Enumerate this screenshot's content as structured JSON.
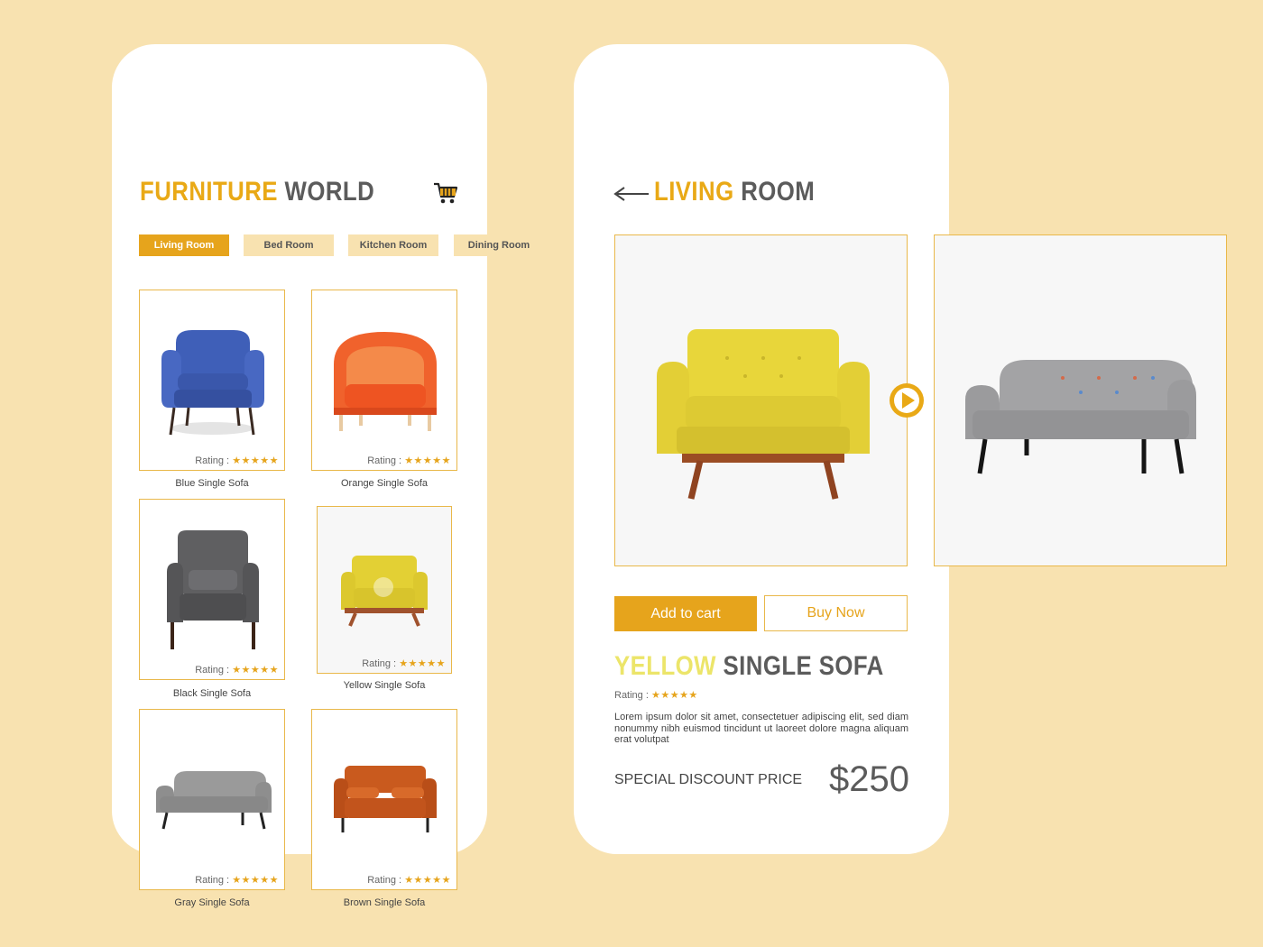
{
  "left": {
    "brand_a": "FURNITURE",
    "brand_b": "WORLD",
    "cart_icon": "shopping-cart-icon",
    "tabs": [
      "Living Room",
      "Bed Room",
      "Kitchen Room",
      "Dining Room"
    ],
    "rating_label": "Rating :",
    "stars": "★★★★★",
    "products": [
      {
        "name": "Blue Single Sofa",
        "color": "#3f5fb8"
      },
      {
        "name": "Orange Single Sofa",
        "color": "#f0622c"
      },
      {
        "name": "Black Single Sofa",
        "color": "#5a5a5c"
      },
      {
        "name": "Yellow Single Sofa",
        "color": "#e6d23a"
      },
      {
        "name": "Gray Single Sofa",
        "color": "#8e8e8e"
      },
      {
        "name": "Brown Single Sofa",
        "color": "#c95a1e"
      }
    ]
  },
  "right": {
    "back_icon": "arrow-left-icon",
    "title_a": "LIVING",
    "title_b": "ROOM",
    "next_icon": "play-icon",
    "add_to_cart": "Add to cart",
    "buy_now": "Buy Now",
    "product_title_a": "YELLOW",
    "product_title_b": "SINGLE SOFA",
    "rating_label": "Rating :",
    "stars": "★★★★★",
    "description": "Lorem ipsum dolor sit amet, consectetuer adipiscing elit, sed diam nonummy nibh euismod tincidunt ut laoreet dolore magna aliquam erat volutpat",
    "price_label": "SPECIAL DISCOUNT PRICE",
    "price": "$250"
  },
  "colors": {
    "accent": "#e6a41c",
    "background": "#f8e2b0",
    "text": "#5b5b5b"
  }
}
